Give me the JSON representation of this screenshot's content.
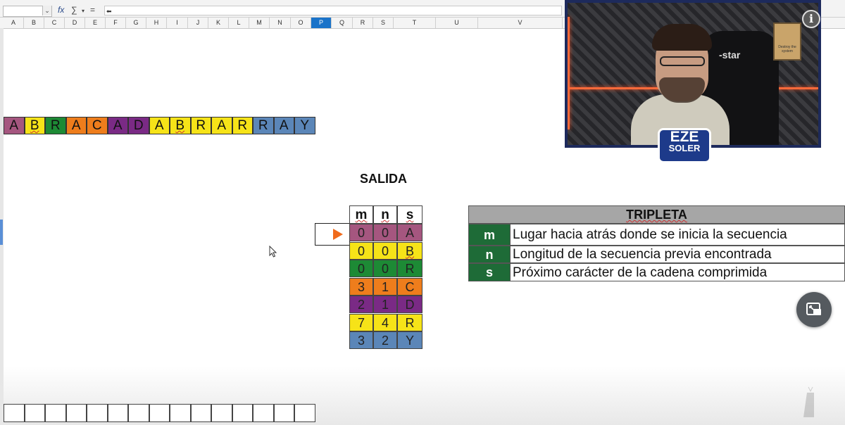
{
  "formula_bar": {
    "fx_label": "fx",
    "sum_label": "∑",
    "sum_arrow": "▾",
    "equals_label": "=",
    "input_value": "⬅",
    "namebox_arrow": "⌄"
  },
  "columns": [
    "A",
    "B",
    "C",
    "D",
    "E",
    "F",
    "G",
    "H",
    "I",
    "J",
    "K",
    "L",
    "M",
    "N",
    "O",
    "P",
    "Q",
    "R",
    "S",
    "T",
    "U",
    "V"
  ],
  "selected_column": "P",
  "sequence": {
    "letters": [
      {
        "char": "A",
        "color": "#a5567f"
      },
      {
        "char": "B",
        "color": "#f6e318"
      },
      {
        "char": "R",
        "color": "#1d8a35"
      },
      {
        "char": "A",
        "color": "#ee7d1c"
      },
      {
        "char": "C",
        "color": "#ee7d1c"
      },
      {
        "char": "A",
        "color": "#7a2a85"
      },
      {
        "char": "D",
        "color": "#7a2a85"
      },
      {
        "char": "A",
        "color": "#f6e318"
      },
      {
        "char": "B",
        "color": "#f6e318"
      },
      {
        "char": "R",
        "color": "#f6e318"
      },
      {
        "char": "A",
        "color": "#f6e318"
      },
      {
        "char": "R",
        "color": "#f6e318"
      },
      {
        "char": "R",
        "color": "#5b86b8"
      },
      {
        "char": "A",
        "color": "#5b86b8"
      },
      {
        "char": "Y",
        "color": "#5b86b8"
      }
    ]
  },
  "output": {
    "title": "SALIDA",
    "headers": [
      "m",
      "n",
      "s"
    ],
    "rows": [
      {
        "m": "0",
        "n": "0",
        "s": "A",
        "color": "#a5567f"
      },
      {
        "m": "0",
        "n": "0",
        "s": "B",
        "color": "#f6e318"
      },
      {
        "m": "0",
        "n": "0",
        "s": "R",
        "color": "#1d8a35"
      },
      {
        "m": "3",
        "n": "1",
        "s": "C",
        "color": "#ee7d1c"
      },
      {
        "m": "2",
        "n": "1",
        "s": "D",
        "color": "#7a2a85"
      },
      {
        "m": "7",
        "n": "4",
        "s": "R",
        "color": "#f6e318"
      },
      {
        "m": "3",
        "n": "2",
        "s": "Y",
        "color": "#5b86b8"
      }
    ]
  },
  "tripleta": {
    "title": "TRIPLETA",
    "rows": [
      {
        "key": "m",
        "text": "Lugar hacia atrás donde se inicia la secuencia"
      },
      {
        "key": "n",
        "text": "Longitud de la secuencia previa encontrada"
      },
      {
        "key": "s",
        "text": "Próximo carácter de la cadena comprimida"
      }
    ]
  },
  "webcam": {
    "chair_text": "-star",
    "chair_text2": "ar",
    "poster_text": "Destroy the system",
    "logo_line1": "EZE",
    "logo_line2": "SOLER"
  },
  "info_icon": "i",
  "colors": {
    "accent_orange": "#f06b1c",
    "tripleta_key_bg": "#1e6b37",
    "webcam_border": "#1d2a5c"
  }
}
